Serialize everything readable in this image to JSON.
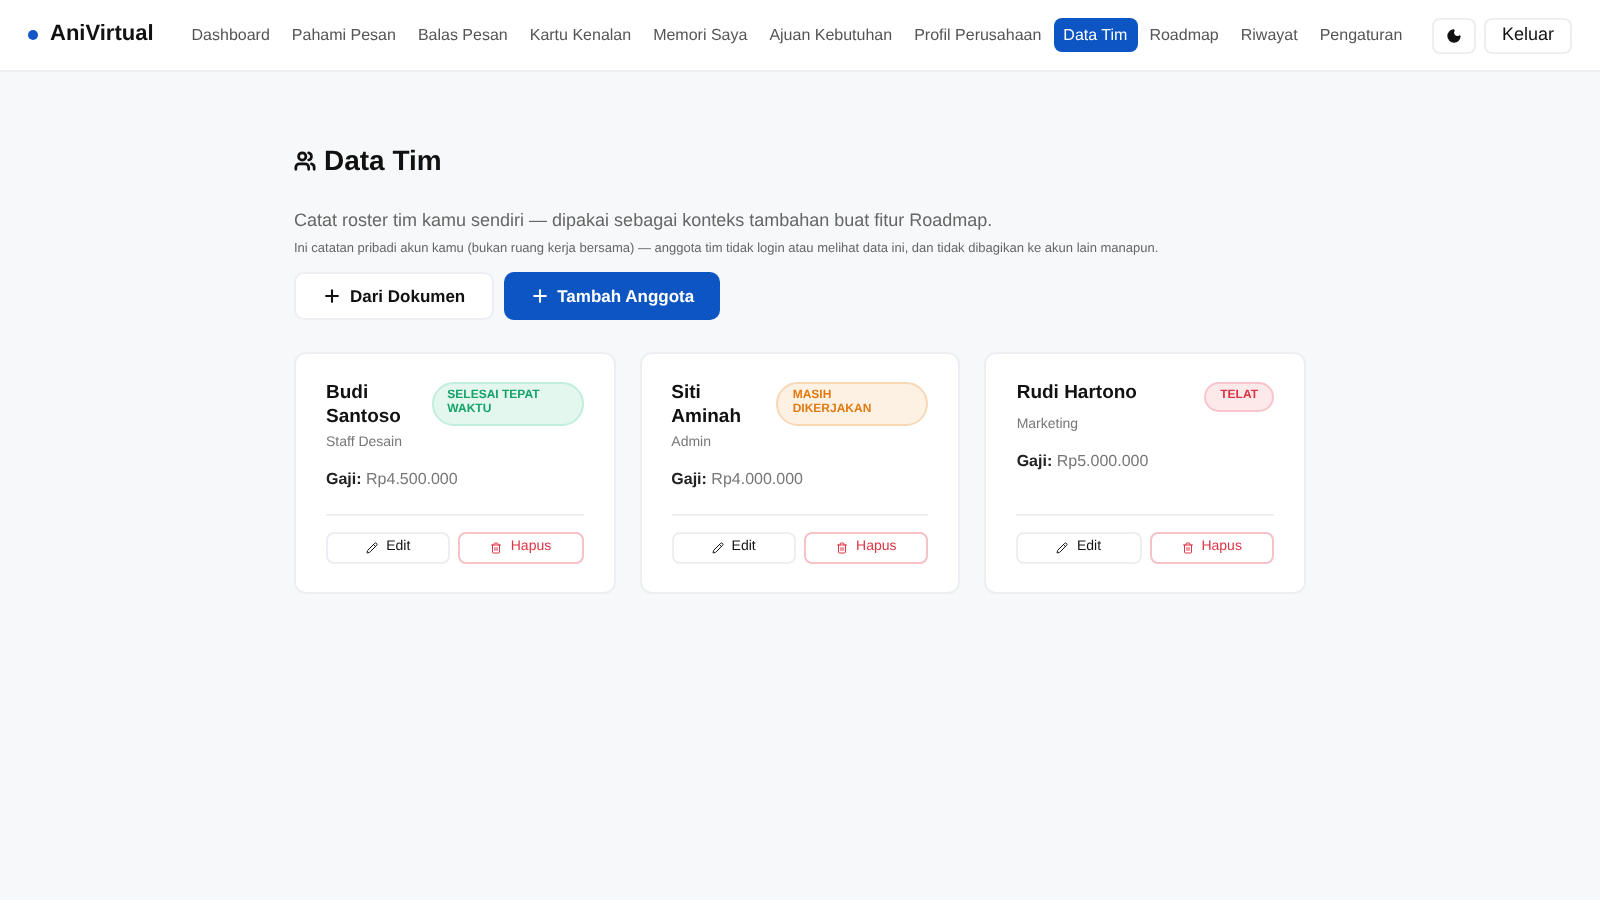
{
  "brand": "AniVirtual",
  "nav": [
    {
      "label": "Dashboard",
      "selected": false
    },
    {
      "label": "Pahami Pesan",
      "selected": false
    },
    {
      "label": "Balas Pesan",
      "selected": false
    },
    {
      "label": "Kartu Kenalan",
      "selected": false
    },
    {
      "label": "Memori Saya",
      "selected": false
    },
    {
      "label": "Ajuan Kebutuhan",
      "selected": false
    },
    {
      "label": "Profil Perusahaan",
      "selected": false
    },
    {
      "label": "Data Tim",
      "selected": true
    },
    {
      "label": "Roadmap",
      "selected": false
    },
    {
      "label": "Riwayat",
      "selected": false
    },
    {
      "label": "Pengaturan",
      "selected": false
    }
  ],
  "logout": "Keluar",
  "title": "Data Tim",
  "description": "Catat roster tim kamu sendiri — dipakai sebagai konteks tambahan buat fitur Roadmap.",
  "note": "Ini catatan pribadi akun kamu (bukan ruang kerja bersama) — anggota tim tidak login atau melihat data ini, dan tidak dibagikan ke akun lain manapun.",
  "actions": [
    {
      "label": "Dari Dokumen",
      "kind": "secondary"
    },
    {
      "label": "Tambah Anggota",
      "kind": "primary"
    }
  ],
  "members": [
    {
      "name": "Budi Santoso",
      "role": "Staff Desain",
      "salary_label": "Gaji:",
      "salary": "Rp4.500.000",
      "status": {
        "label": "SELESAI TEPAT WAKTU",
        "kind": "done"
      },
      "edit": "Edit",
      "delete": "Hapus"
    },
    {
      "name": "Siti Aminah",
      "role": "Admin",
      "salary_label": "Gaji:",
      "salary": "Rp4.000.000",
      "status": {
        "label": "MASIH DIKERJAKAN",
        "kind": "progress"
      },
      "edit": "Edit",
      "delete": "Hapus"
    },
    {
      "name": "Rudi Hartono",
      "role": "Marketing",
      "salary_label": "Gaji:",
      "salary": "Rp5.000.000",
      "status": {
        "label": "TELAT",
        "kind": "late"
      },
      "edit": "Edit",
      "delete": "Hapus"
    }
  ]
}
